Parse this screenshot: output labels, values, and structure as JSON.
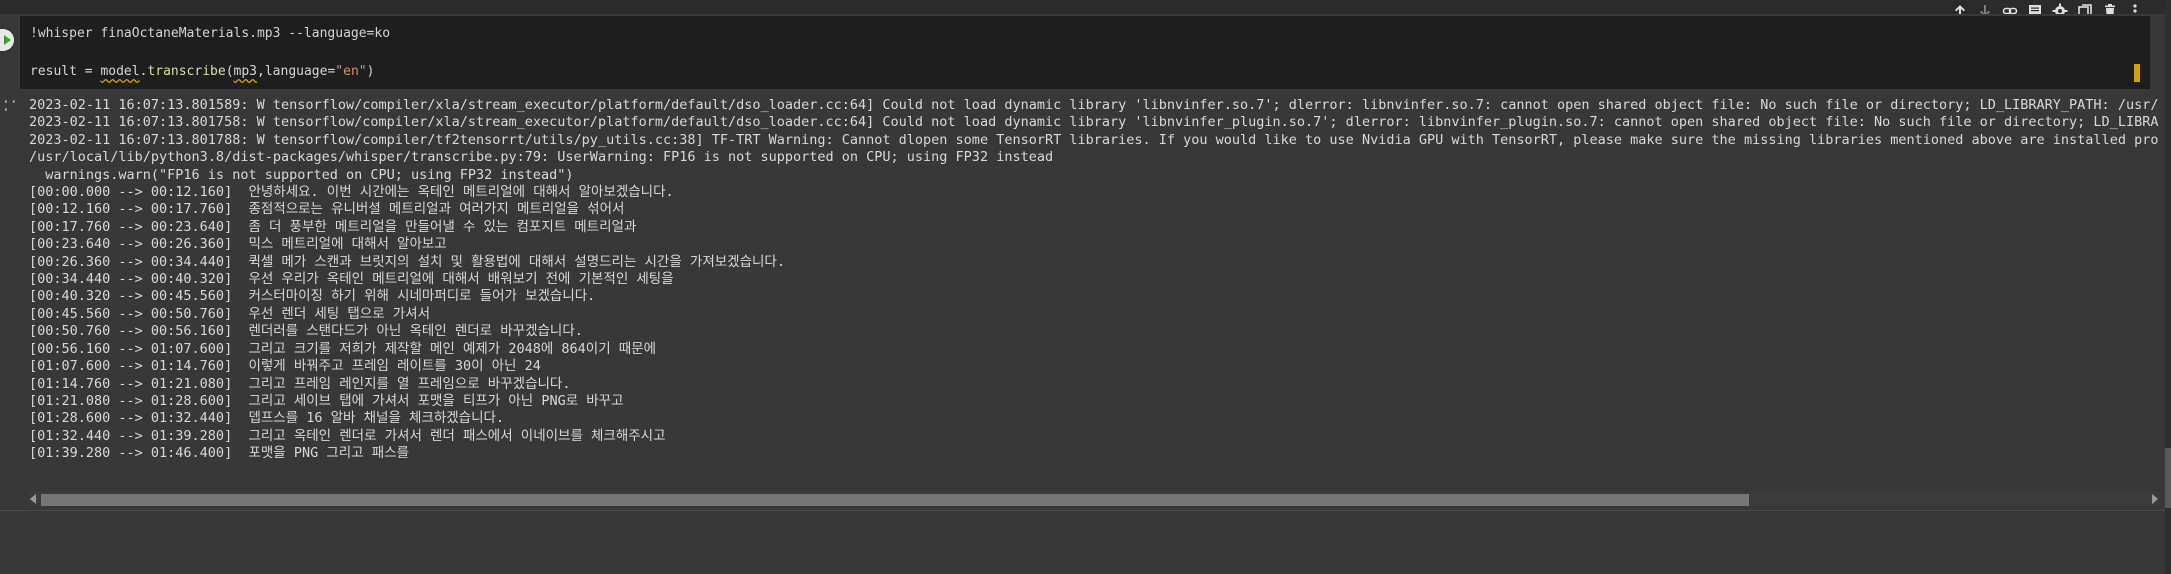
{
  "cell": {
    "line1": "!whisper finaOctaneMaterials.mp3 --language=ko",
    "line2_parts": {
      "a": "result = ",
      "b": "model",
      "c": ".",
      "d": "transcribe",
      "e": "(",
      "f": "mp3",
      "g": ",language=",
      "h": "\"en\"",
      "i": ")"
    }
  },
  "toolbar": {
    "icons": [
      "arrow-up-icon",
      "arrow-down-icon",
      "link-icon",
      "comment-icon",
      "gear-icon",
      "mirror-icon",
      "delete-icon",
      "more-icon"
    ]
  },
  "output": {
    "lines": [
      "2023-02-11 16:07:13.801589: W tensorflow/compiler/xla/stream_executor/platform/default/dso_loader.cc:64] Could not load dynamic library 'libnvinfer.so.7'; dlerror: libnvinfer.so.7: cannot open shared object file: No such file or directory; LD_LIBRARY_PATH: /usr/local",
      "2023-02-11 16:07:13.801758: W tensorflow/compiler/xla/stream_executor/platform/default/dso_loader.cc:64] Could not load dynamic library 'libnvinfer_plugin.so.7'; dlerror: libnvinfer_plugin.so.7: cannot open shared object file: No such file or directory; LD_LIBRARY_PA",
      "2023-02-11 16:07:13.801788: W tensorflow/compiler/tf2tensorrt/utils/py_utils.cc:38] TF-TRT Warning: Cannot dlopen some TensorRT libraries. If you would like to use Nvidia GPU with TensorRT, please make sure the missing libraries mentioned above are installed properly",
      "/usr/local/lib/python3.8/dist-packages/whisper/transcribe.py:79: UserWarning: FP16 is not supported on CPU; using FP32 instead",
      "  warnings.warn(\"FP16 is not supported on CPU; using FP32 instead\")",
      "[00:00.000 --> 00:12.160]  안녕하세요. 이번 시간에는 옥테인 메트리얼에 대해서 알아보겠습니다.",
      "[00:12.160 --> 00:17.760]  종점적으로는 유니버셜 메트리얼과 여러가지 메트리얼을 섞어서",
      "[00:17.760 --> 00:23.640]  좀 더 풍부한 메트리얼을 만들어낼 수 있는 컴포지트 메트리얼과",
      "[00:23.640 --> 00:26.360]  믹스 메트리얼에 대해서 알아보고",
      "[00:26.360 --> 00:34.440]  퀵셀 메가 스캔과 브릿지의 설치 및 활용법에 대해서 설명드리는 시간을 가져보겠습니다.",
      "[00:34.440 --> 00:40.320]  우선 우리가 옥테인 메트리얼에 대해서 배워보기 전에 기본적인 세팅을",
      "[00:40.320 --> 00:45.560]  커스터마이징 하기 위해 시네마퍼디로 들어가 보겠습니다.",
      "[00:45.560 --> 00:50.760]  우선 렌더 세팅 탭으로 가셔서",
      "[00:50.760 --> 00:56.160]  렌더러를 스탠다드가 아닌 옥테인 렌더로 바꾸겠습니다.",
      "[00:56.160 --> 01:07.600]  그리고 크기를 저희가 제작할 메인 예제가 2048에 864이기 때문에",
      "[01:07.600 --> 01:14.760]  이렇게 바꿔주고 프레임 레이트를 30이 아닌 24",
      "[01:14.760 --> 01:21.080]  그리고 프레임 레인지를 열 프레임으로 바꾸겠습니다.",
      "[01:21.080 --> 01:28.600]  그리고 세이브 탭에 가셔서 포맷을 티프가 아닌 PNG로 바꾸고",
      "[01:28.600 --> 01:32.440]  뎁프스를 16 알바 채널을 체크하겠습니다.",
      "[01:32.440 --> 01:39.280]  그리고 옥테인 렌더로 가셔서 렌더 패스에서 이네이브를 체크해주시고",
      "[01:39.280 --> 01:46.400]  포맷을 PNG 그리고 패스를"
    ]
  },
  "colors": {
    "background": "#383838",
    "code_bg": "#1e1e1e",
    "text": "#d8d8d8",
    "accent": "#d7a200"
  }
}
